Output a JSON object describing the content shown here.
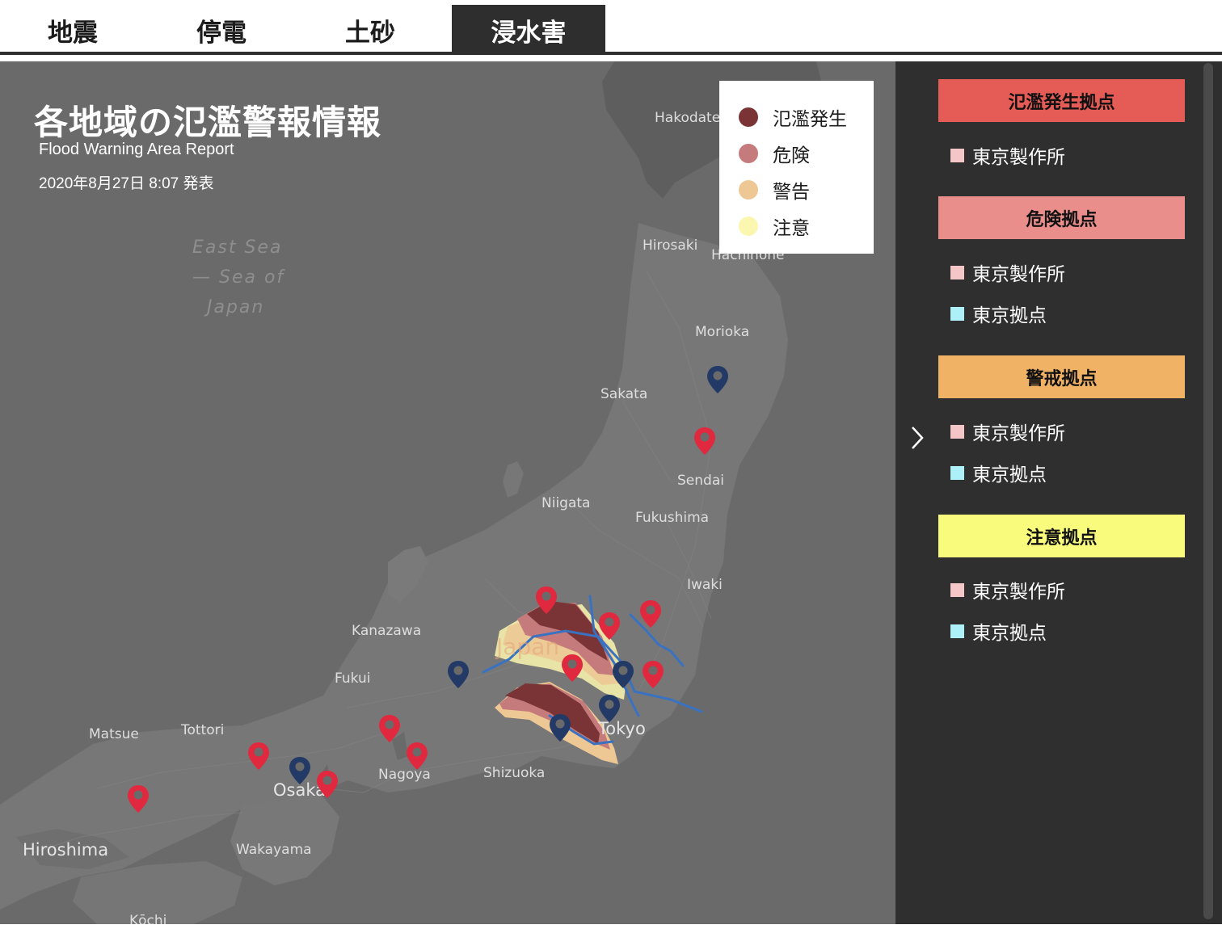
{
  "tabs": [
    {
      "label": "地震",
      "active": false
    },
    {
      "label": "停電",
      "active": false
    },
    {
      "label": "土砂",
      "active": false
    },
    {
      "label": "浸水害",
      "active": true
    }
  ],
  "map": {
    "title": "各地域の氾濫警報情報",
    "subtitle": "Flood Warning Area Report",
    "date": "2020年8月27日 8:07 発表",
    "sea_labels": [
      "East Sea",
      "— Sea of",
      "Japan"
    ],
    "cities": {
      "hakodate": "Hakodate",
      "hirosaki": "Hirosaki",
      "hachinohe": "Hachinohe",
      "morioka": "Morioka",
      "sakata": "Sakata",
      "sendai": "Sendai",
      "niigata": "Niigata",
      "fukushima": "Fukushima",
      "iwaki": "Iwaki",
      "kanazawa": "Kanazawa",
      "fukui": "Fukui",
      "tokyo": "Tokyo",
      "shizuoka": "Shizuoka",
      "nagoya": "Nagoya",
      "matsue": "Matsue",
      "tottori": "Tottori",
      "osaka": "Osaka",
      "hiroshima": "Hiroshima",
      "wakayama": "Wakayama",
      "kochi": "Kōchi",
      "japan": "Japan"
    },
    "pin_colors": {
      "red": "#e0293f",
      "blue": "#233a66"
    }
  },
  "legend": [
    {
      "label": "氾濫発生",
      "color": "#7a3436"
    },
    {
      "label": "危険",
      "color": "#c57b7b"
    },
    {
      "label": "警告",
      "color": "#edc894"
    },
    {
      "label": "注意",
      "color": "#fbf7b0"
    }
  ],
  "panel": {
    "groups": [
      {
        "title": "氾濫発生拠点",
        "color": "#e55c57",
        "sites": [
          {
            "label": "東京製作所",
            "color": "#f4c6c8"
          }
        ]
      },
      {
        "title": "危険拠点",
        "color": "#ea8e8c",
        "sites": [
          {
            "label": "東京製作所",
            "color": "#f4c6c8"
          },
          {
            "label": "東京拠点",
            "color": "#aef0f8"
          }
        ]
      },
      {
        "title": "警戒拠点",
        "color": "#f0b264",
        "sites": [
          {
            "label": "東京製作所",
            "color": "#f4c6c8"
          },
          {
            "label": "東京拠点",
            "color": "#aef0f8"
          }
        ]
      },
      {
        "title": "注意拠点",
        "color": "#f9fb7c",
        "sites": [
          {
            "label": "東京製作所",
            "color": "#f4c6c8"
          },
          {
            "label": "東京拠点",
            "color": "#aef0f8"
          }
        ]
      }
    ]
  }
}
